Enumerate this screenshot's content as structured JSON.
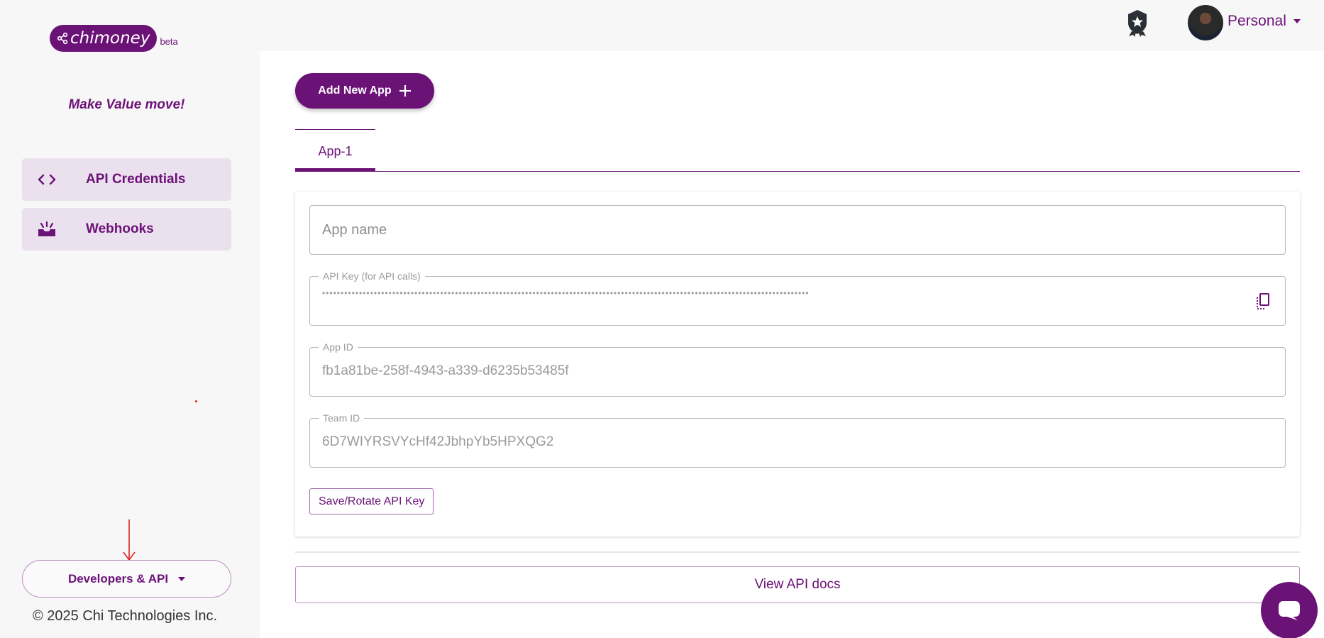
{
  "brand": {
    "name": "chimoney",
    "badge": "beta",
    "tagline": "Make Value move!"
  },
  "sidebar": {
    "items": [
      {
        "label": "API Credentials",
        "icon": "code-icon"
      },
      {
        "label": "Webhooks",
        "icon": "inbox-icon"
      }
    ],
    "dev_menu_label": "Developers & API",
    "copyright": "© 2025 Chi Technologies Inc."
  },
  "header": {
    "account_label": "Personal"
  },
  "main": {
    "add_app_label": "Add New App",
    "tabs": [
      {
        "label": "App-1"
      }
    ],
    "form": {
      "app_name_placeholder": "App name",
      "api_key_label": "API Key (for API calls)",
      "api_key_masked": "••••••••••••••••••••••••••••••••••••••••••••••••••••••••••••••••••••••••••••••••••••••••••••••••••••••••••••••••••••••••••••••••••••",
      "app_id_label": "App ID",
      "app_id_value": "fb1a81be-258f-4943-a339-d6235b53485f",
      "team_id_label": "Team ID",
      "team_id_value": "6D7WIYRSVYcHf42JbhpYb5HPXQG2",
      "save_label": "Save/Rotate API Key"
    },
    "docs_label": "View API docs"
  },
  "colors": {
    "brand": "#6b1277",
    "nav_bg": "#ebe0ed",
    "annotation": "#e02020"
  }
}
